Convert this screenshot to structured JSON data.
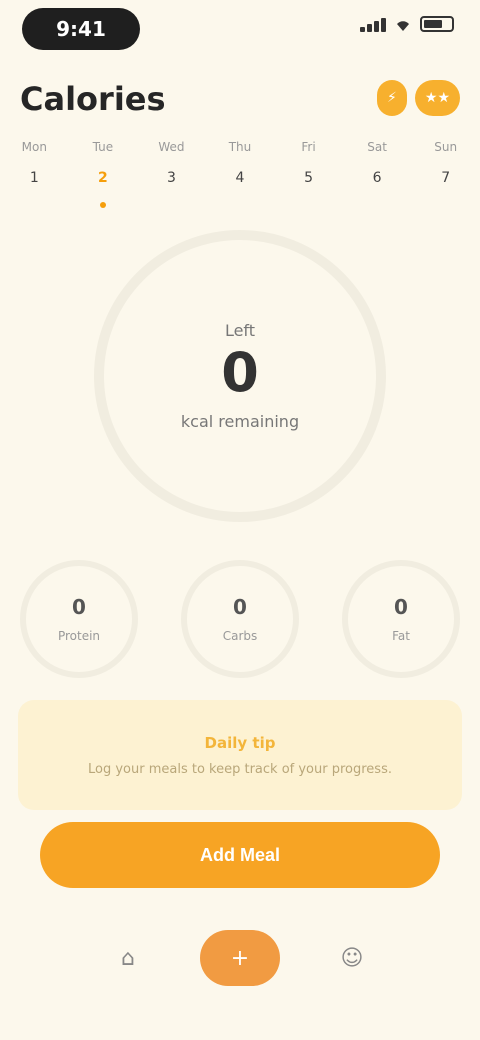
{
  "status_bar": {
    "time": "9:41",
    "icons": [
      "signal-icon",
      "wifi-icon",
      "battery-icon"
    ]
  },
  "header": {
    "title": "Calories",
    "pills": [
      "⚡",
      "★★"
    ]
  },
  "week": [
    {
      "name": "Mon",
      "num": "1"
    },
    {
      "name": "Tue",
      "num": "2"
    },
    {
      "name": "Wed",
      "num": "3"
    },
    {
      "name": "Thu",
      "num": "4"
    },
    {
      "name": "Fri",
      "num": "5"
    },
    {
      "name": "Sat",
      "num": "6"
    },
    {
      "name": "Sun",
      "num": "7"
    }
  ],
  "active_day": 1,
  "ring": {
    "label": "Left",
    "value": "0",
    "sub": "kcal remaining"
  },
  "minis": [
    {
      "value": "0",
      "label": "Protein"
    },
    {
      "value": "0",
      "label": "Carbs"
    },
    {
      "value": "0",
      "label": "Fat"
    }
  ],
  "tip": {
    "title": "Daily tip",
    "text": "Log your meals to keep track of your progress."
  },
  "primary_button": "Add Meal",
  "nav": {
    "left_icon": "home-icon",
    "center_icon": "plus-icon",
    "right_icon": "profile-icon"
  },
  "colors": {
    "background": "#fcf8ec",
    "accent": "#f7a424",
    "tip_bg": "#fdf2d2"
  }
}
